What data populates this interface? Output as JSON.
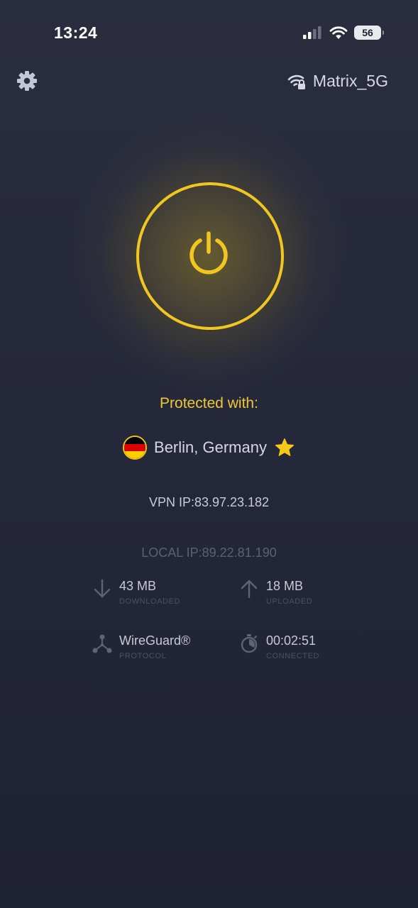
{
  "status_bar": {
    "time": "13:24",
    "battery": "56",
    "icons": [
      "cellular-signal-icon",
      "wifi-icon",
      "battery-icon"
    ]
  },
  "top_bar": {
    "settings_icon": "gear-icon",
    "network_icon": "wifi-lock-icon",
    "network_name": "Matrix_5G"
  },
  "connection": {
    "power_icon": "power-icon",
    "status_text": "Protected with:",
    "location": "Berlin, Germany",
    "flag": "germany-flag-icon",
    "favorite_icon": "star-icon",
    "vpn_ip": "VPN IP:83.97.23.182",
    "local_ip": "LOCAL IP:89.22.81.190"
  },
  "stats": {
    "downloaded": {
      "value": "43 MB",
      "label": "DOWNLOADED",
      "icon": "arrow-down-icon"
    },
    "uploaded": {
      "value": "18 MB",
      "label": "UPLOADED",
      "icon": "arrow-up-icon"
    },
    "protocol": {
      "value": "WireGuard®",
      "label": "PROTOCOL",
      "icon": "protocol-nodes-icon"
    },
    "connected": {
      "value": "00:02:51",
      "label": "CONNECTED",
      "icon": "stopwatch-icon"
    }
  },
  "colors": {
    "accent": "#f2c620",
    "background": "#262939",
    "text_primary": "#d5d7e5",
    "text_muted": "#5d6075"
  }
}
